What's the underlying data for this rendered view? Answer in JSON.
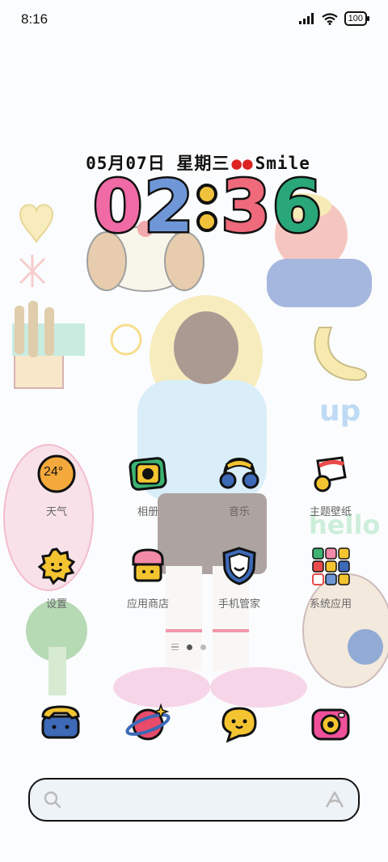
{
  "status_bar": {
    "time": "8:16",
    "battery": "100"
  },
  "widget": {
    "date": "05月07日 星期三",
    "motto": "Smile",
    "clock_digits": [
      "0",
      "2",
      "3",
      "6"
    ],
    "digit_colors": [
      "#f06aa5",
      "#6f97d8",
      "#f0c23c",
      "#ef6a7a",
      "#2aa779"
    ]
  },
  "apps": [
    {
      "label": "天气",
      "badge": "24°",
      "icon": "weather-icon"
    },
    {
      "label": "相册",
      "icon": "gallery-icon"
    },
    {
      "label": "音乐",
      "icon": "music-icon"
    },
    {
      "label": "主题壁纸",
      "icon": "theme-icon"
    },
    {
      "label": "设置",
      "icon": "settings-icon"
    },
    {
      "label": "应用商店",
      "icon": "app-store-icon"
    },
    {
      "label": "手机管家",
      "icon": "security-icon"
    },
    {
      "label": "系统应用",
      "icon": "system-apps-folder-icon"
    }
  ],
  "dock": [
    {
      "icon": "phone-icon"
    },
    {
      "icon": "browser-icon"
    },
    {
      "icon": "messages-icon"
    },
    {
      "icon": "camera-icon"
    }
  ],
  "page_indicator": {
    "pages": 2,
    "current": 1
  },
  "colors": {
    "accent_yellow": "#f4c430",
    "accent_pink": "#f06aa5",
    "accent_blue": "#6f97d8",
    "accent_green": "#2aa779"
  }
}
